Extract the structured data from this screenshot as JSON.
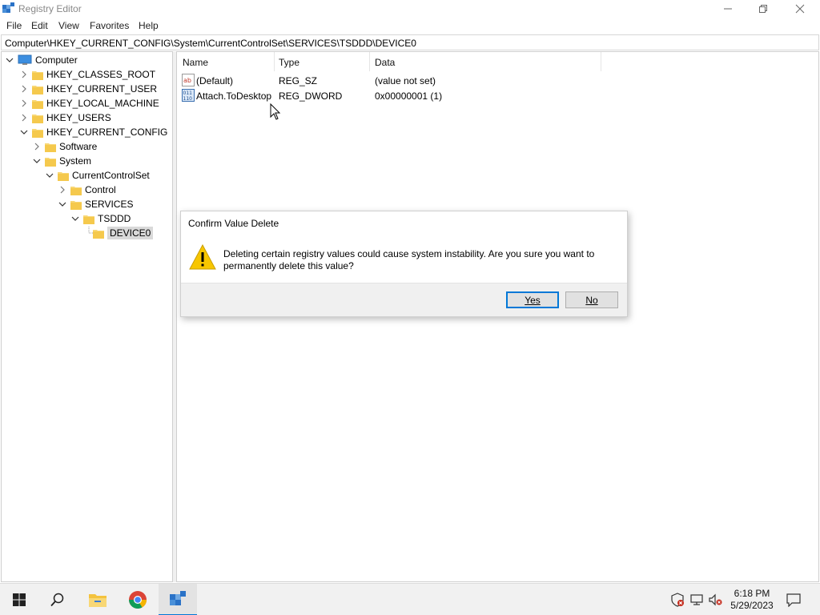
{
  "window": {
    "title": "Registry Editor",
    "menu": [
      "File",
      "Edit",
      "View",
      "Favorites",
      "Help"
    ],
    "address": "Computer\\HKEY_CURRENT_CONFIG\\System\\CurrentControlSet\\SERVICES\\TSDDD\\DEVICE0"
  },
  "tree": {
    "items": [
      {
        "label": "Computer",
        "icon": "computer-icon",
        "expanded": true
      },
      {
        "label": "HKEY_CLASSES_ROOT",
        "icon": "folder-icon",
        "expanded": false
      },
      {
        "label": "HKEY_CURRENT_USER",
        "icon": "folder-icon",
        "expanded": false
      },
      {
        "label": "HKEY_LOCAL_MACHINE",
        "icon": "folder-icon",
        "expanded": false
      },
      {
        "label": "HKEY_USERS",
        "icon": "folder-icon",
        "expanded": false
      },
      {
        "label": "HKEY_CURRENT_CONFIG",
        "icon": "folder-icon",
        "expanded": true
      },
      {
        "label": "Software",
        "icon": "folder-icon",
        "expanded": false
      },
      {
        "label": "System",
        "icon": "folder-icon",
        "expanded": true
      },
      {
        "label": "CurrentControlSet",
        "icon": "folder-icon",
        "expanded": true
      },
      {
        "label": "Control",
        "icon": "folder-icon",
        "expanded": false
      },
      {
        "label": "SERVICES",
        "icon": "folder-icon",
        "expanded": true
      },
      {
        "label": "TSDDD",
        "icon": "folder-icon",
        "expanded": true
      },
      {
        "label": "DEVICE0",
        "icon": "folder-icon",
        "selected": true
      }
    ]
  },
  "list": {
    "columns": [
      "Name",
      "Type",
      "Data"
    ],
    "rows": [
      {
        "name": "(Default)",
        "type": "REG_SZ",
        "data": "(value not set)",
        "icon": "string-value-icon"
      },
      {
        "name": "Attach.ToDesktop",
        "type": "REG_DWORD",
        "data": "0x00000001 (1)",
        "icon": "binary-value-icon"
      }
    ]
  },
  "dialog": {
    "title": "Confirm Value Delete",
    "message": "Deleting certain registry values could cause system instability. Are you sure you want to permanently delete this value?",
    "yes_label": "Yes",
    "no_label": "No"
  },
  "taskbar": {
    "time": "6:18 PM",
    "date": "5/29/2023",
    "accent": "#0078d7"
  }
}
